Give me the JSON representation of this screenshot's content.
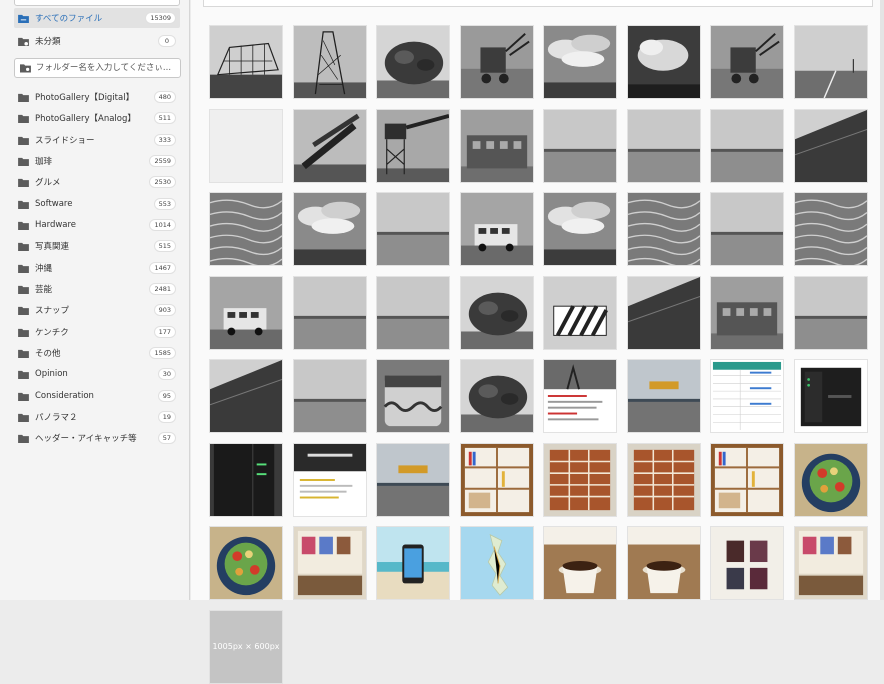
{
  "sidebar": {
    "all_files": {
      "label": "すべてのファイル",
      "count": "15309"
    },
    "uncategorized": {
      "label": "未分類",
      "count": "0"
    },
    "search": {
      "placeholder": "フォルダー名を入力してくださぃ..."
    },
    "folders": [
      {
        "label": "PhotoGallery【Digital】",
        "count": "480"
      },
      {
        "label": "PhotoGallery【Analog】",
        "count": "511"
      },
      {
        "label": "スライドショー",
        "count": "333"
      },
      {
        "label": "珈琲",
        "count": "2559"
      },
      {
        "label": "グルメ",
        "count": "2530"
      },
      {
        "label": "Software",
        "count": "553"
      },
      {
        "label": "Hardware",
        "count": "1014"
      },
      {
        "label": "写真関連",
        "count": "515"
      },
      {
        "label": "沖縄",
        "count": "1467"
      },
      {
        "label": "芸能",
        "count": "2481"
      },
      {
        "label": "スナップ",
        "count": "903"
      },
      {
        "label": "ケンチク",
        "count": "177"
      },
      {
        "label": "その他",
        "count": "1585"
      },
      {
        "label": "Opinion",
        "count": "30"
      },
      {
        "label": "Consideration",
        "count": "95"
      },
      {
        "label": "パノラマ２",
        "count": "19"
      },
      {
        "label": "ヘッダー・アイキャッチ等",
        "count": "57"
      }
    ]
  },
  "grid": {
    "thumbnails": [
      {
        "name": "greenhouse-frame",
        "kind": "greenhouse"
      },
      {
        "name": "crane-tower",
        "kind": "lattice"
      },
      {
        "name": "tree-bush",
        "kind": "tree"
      },
      {
        "name": "crane-machine",
        "kind": "machine"
      },
      {
        "name": "cloudy-sky",
        "kind": "clouds"
      },
      {
        "name": "dark-clouds",
        "kind": "darkclouds"
      },
      {
        "name": "rusty-machinery",
        "kind": "machine"
      },
      {
        "name": "coastal-road",
        "kind": "road"
      },
      {
        "name": "blank-white",
        "kind": "blank"
      },
      {
        "name": "crossed-beams",
        "kind": "beams"
      },
      {
        "name": "conveyor-tower",
        "kind": "conveyor"
      },
      {
        "name": "industrial-building",
        "kind": "building"
      },
      {
        "name": "flat-horizon",
        "kind": "horizon"
      },
      {
        "name": "seawall-fence",
        "kind": "horizon"
      },
      {
        "name": "empty-beach",
        "kind": "horizon"
      },
      {
        "name": "diagonal-wall",
        "kind": "diagonal"
      },
      {
        "name": "sand-dunes",
        "kind": "sand"
      },
      {
        "name": "clouds-over-plain",
        "kind": "clouds"
      },
      {
        "name": "fence-field",
        "kind": "horizon"
      },
      {
        "name": "parked-truck",
        "kind": "vehicle"
      },
      {
        "name": "street-lamps",
        "kind": "clouds"
      },
      {
        "name": "pebble-ground",
        "kind": "sand"
      },
      {
        "name": "gray-sea",
        "kind": "horizon"
      },
      {
        "name": "tire-tracks",
        "kind": "sand"
      },
      {
        "name": "old-bus",
        "kind": "vehicle"
      },
      {
        "name": "small-shed",
        "kind": "horizon"
      },
      {
        "name": "grass-field",
        "kind": "horizon"
      },
      {
        "name": "dense-shrubs",
        "kind": "tree"
      },
      {
        "name": "striped-barrier",
        "kind": "barrier"
      },
      {
        "name": "alley-walls",
        "kind": "diagonal"
      },
      {
        "name": "long-building",
        "kind": "building"
      },
      {
        "name": "bright-sky",
        "kind": "horizon"
      },
      {
        "name": "sloped-field",
        "kind": "diagonal"
      },
      {
        "name": "calm-sea",
        "kind": "horizon"
      },
      {
        "name": "water-tank",
        "kind": "tank"
      },
      {
        "name": "trees-and-car",
        "kind": "tree"
      },
      {
        "name": "harbor-screenshot",
        "kind": "webpage"
      },
      {
        "name": "airport-runway",
        "kind": "runway"
      },
      {
        "name": "spec-table",
        "kind": "table"
      },
      {
        "name": "nas-device",
        "kind": "nas"
      },
      {
        "name": "pc-tower",
        "kind": "tower"
      },
      {
        "name": "dark-website",
        "kind": "darkweb"
      },
      {
        "name": "runway-blog-header",
        "kind": "runway"
      },
      {
        "name": "bookshelf",
        "kind": "shelf"
      },
      {
        "name": "storage-drawers",
        "kind": "drawers"
      },
      {
        "name": "drawer-cabinet",
        "kind": "drawers"
      },
      {
        "name": "record-shelves",
        "kind": "shelf"
      },
      {
        "name": "salad-plate",
        "kind": "salad"
      },
      {
        "name": "salad-plate-2",
        "kind": "salad"
      },
      {
        "name": "shop-counter",
        "kind": "shop"
      },
      {
        "name": "phone-on-beach",
        "kind": "phone"
      },
      {
        "name": "okinawa-map",
        "kind": "map"
      },
      {
        "name": "coffee-cup",
        "kind": "coffee"
      },
      {
        "name": "coffee-table",
        "kind": "coffee"
      },
      {
        "name": "book-display",
        "kind": "display"
      },
      {
        "name": "shop-entrance",
        "kind": "shop"
      },
      {
        "name": "placeholder",
        "kind": "placeholder",
        "label": "1005px × 600px"
      }
    ]
  }
}
